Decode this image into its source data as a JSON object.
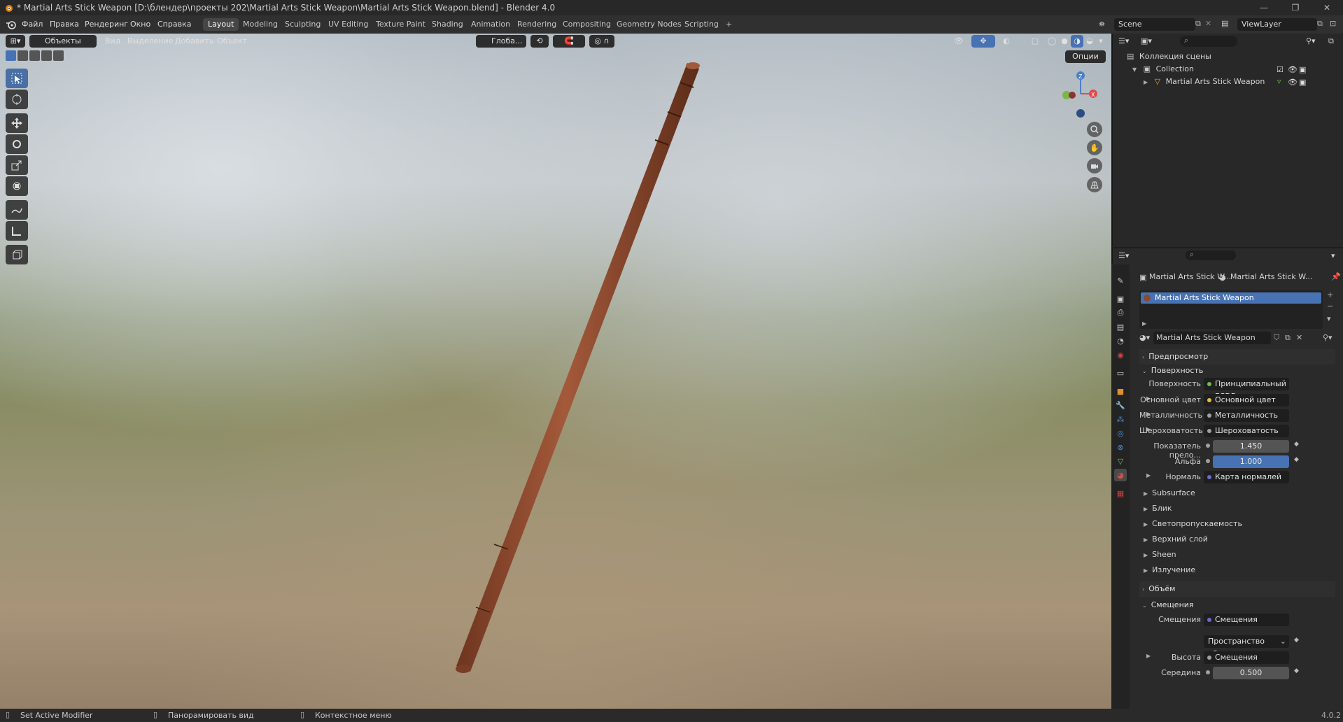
{
  "window": {
    "title": "* Martial Arts Stick Weapon [D:\\блендер\\проекты 202\\Martial Arts Stick Weapon\\Martial Arts Stick Weapon.blend] - Blender 4.0"
  },
  "menu": [
    "Файл",
    "Правка",
    "Рендеринг",
    "Окно",
    "Справка"
  ],
  "workspaces": [
    "Layout",
    "Modeling",
    "Sculpting",
    "UV Editing",
    "Texture Paint",
    "Shading",
    "Animation",
    "Rendering",
    "Compositing",
    "Geometry Nodes",
    "Scripting"
  ],
  "active_workspace": "Layout",
  "scene": "Scene",
  "view_layer": "ViewLayer",
  "viewport": {
    "mode": "Объекты",
    "menus": [
      "Вид",
      "Выделение",
      "Добавить",
      "Объект"
    ],
    "orientation": "Глоба...",
    "options": "Опции",
    "axis_labels": {
      "z": "Z",
      "x": "X"
    }
  },
  "outliner": {
    "root": "Коллекция сцены",
    "collection": "Collection",
    "object": "Martial Arts Stick Weapon"
  },
  "properties": {
    "breadcrumb_object": "Martial Arts Stick W...",
    "breadcrumb_material": "Martial Arts Stick W...",
    "material_slot": "Martial Arts Stick Weapon",
    "material_name": "Martial Arts Stick Weapon",
    "preview_section": "Предпросмотр",
    "surface_section": "Поверхность",
    "surface_label": "Поверхность",
    "surface_value": "Принципиальный BSDF",
    "rows": [
      {
        "label": "Основной цвет",
        "value": "Основной цвет"
      },
      {
        "label": "Металличность",
        "value": "Металличность"
      },
      {
        "label": "Шероховатость",
        "value": "Шероховатость"
      }
    ],
    "ior_label": "Показатель прело...",
    "ior_value": "1.450",
    "alpha_label": "Альфа",
    "alpha_value": "1.000",
    "normal_label": "Нормаль",
    "normal_value": "Карта нормалей",
    "subsections": [
      "Subsurface",
      "Блик",
      "Светопропускаемость",
      "Верхний слой",
      "Sheen",
      "Излучение"
    ],
    "volume_section": "Объём",
    "displacement_section": "Смещения",
    "displacement_label": "Смещения",
    "displacement_value": "Смещения",
    "space_value": "Пространство объекта",
    "height_label": "Высота",
    "height_value": "Смещения",
    "midlevel_label": "Середина",
    "midlevel_value": "0.500"
  },
  "status": {
    "left": "Set Active Modifier",
    "middle": "Панорамировать вид",
    "right": "Контекстное меню",
    "version": "4.0.2"
  },
  "colors": {
    "accent": "#4772b3",
    "stick": "#8a4a30",
    "axis_x": "#e04b4b",
    "axis_y": "#7ab648",
    "axis_z": "#4a7fc8"
  }
}
